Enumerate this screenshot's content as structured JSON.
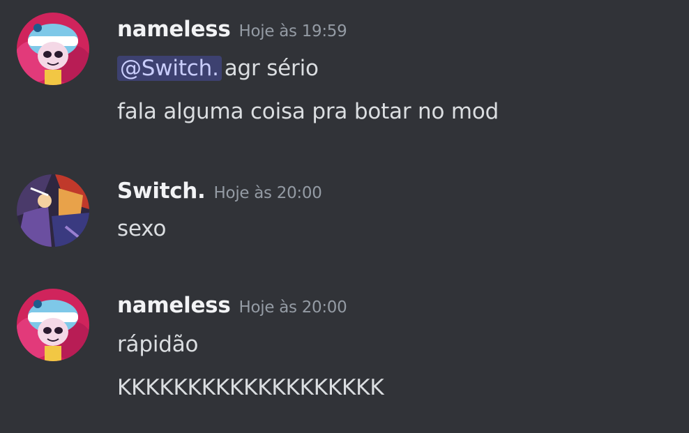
{
  "messages": [
    {
      "author": "nameless",
      "timestamp": "Hoje às 19:59",
      "lines": [
        {
          "mention": "@Switch.",
          "text": "agr sério"
        },
        {
          "text": "fala alguma coisa pra botar no mod"
        }
      ]
    },
    {
      "author": "Switch.",
      "timestamp": "Hoje às 20:00",
      "lines": [
        {
          "text": "sexo"
        }
      ]
    },
    {
      "author": "nameless",
      "timestamp": "Hoje às 20:00",
      "lines": [
        {
          "text": "rápidão"
        },
        {
          "text": "KKKKKKKKKKKKKKKKKKK"
        }
      ]
    }
  ],
  "colors": {
    "background": "#313338",
    "username": "#f2f3f5",
    "timestamp": "#949ba4",
    "text": "#dbdee1",
    "mention_bg": "#3c4270",
    "mention_text": "#c9cdfb"
  }
}
